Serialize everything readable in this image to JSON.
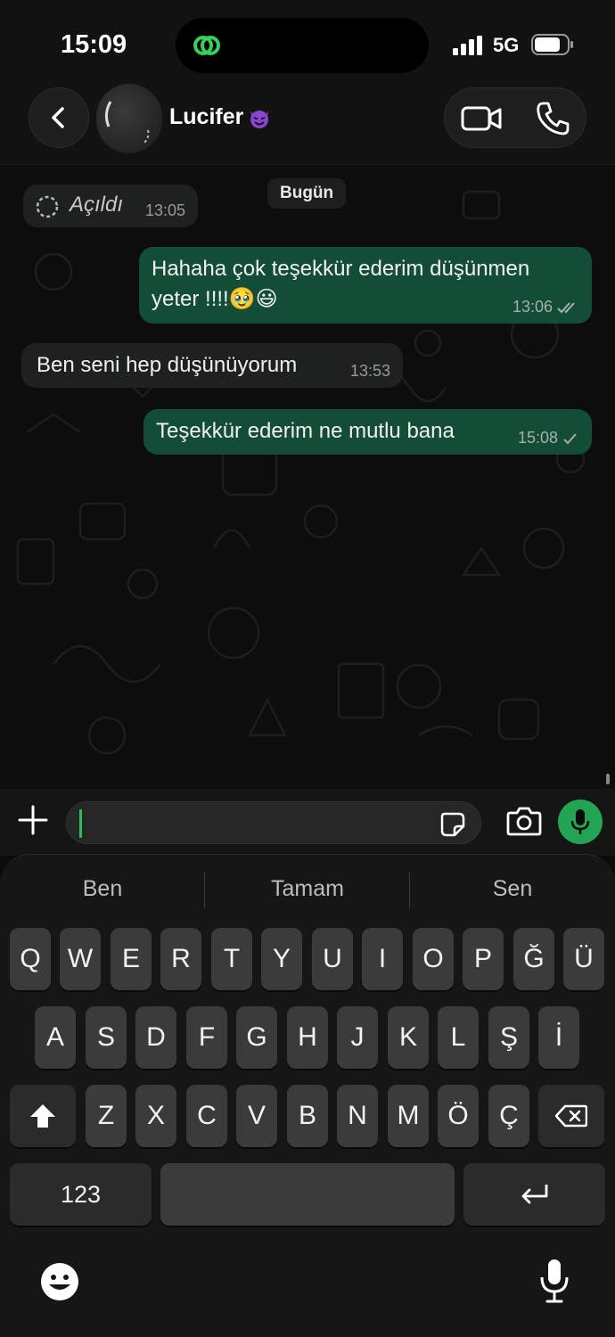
{
  "status_bar": {
    "time": "15:09",
    "network": "5G"
  },
  "header": {
    "contact_name": "Lucifer",
    "contact_emoji": "😈"
  },
  "chat": {
    "date_label": "Bugün",
    "opened_label": "Açıldı",
    "opened_time": "13:05",
    "messages": [
      {
        "direction": "out",
        "line1": "Hahaha çok teşekkür ederim düşünmen",
        "line2": "yeter !!!!🥹😃",
        "time": "13:06",
        "status": "read"
      },
      {
        "direction": "in",
        "text": "Ben seni hep düşünüyorum",
        "time": "13:53"
      },
      {
        "direction": "out",
        "text": "Teşekkür ederim ne mutlu bana",
        "time": "15:08",
        "status": "sent"
      }
    ]
  },
  "input": {
    "value": ""
  },
  "keyboard": {
    "suggestions": [
      "Ben",
      "Tamam",
      "Sen"
    ],
    "row1": [
      "Q",
      "W",
      "E",
      "R",
      "T",
      "Y",
      "U",
      "I",
      "O",
      "P",
      "Ğ",
      "Ü"
    ],
    "row2": [
      "A",
      "S",
      "D",
      "F",
      "G",
      "H",
      "J",
      "K",
      "L",
      "Ş",
      "İ"
    ],
    "row3": [
      "Z",
      "X",
      "C",
      "V",
      "B",
      "N",
      "M",
      "Ö",
      "Ç"
    ],
    "numbers_label": "123"
  },
  "colors": {
    "outgoing_bubble": "#134d37",
    "incoming_bubble": "#1f2020",
    "accent_green": "#23a455"
  },
  "icons": [
    "chevron-left-icon",
    "video-icon",
    "phone-icon",
    "plus-icon",
    "sticker-icon",
    "camera-icon",
    "microphone-icon",
    "shift-icon",
    "backspace-icon",
    "return-icon",
    "emoji-icon"
  ]
}
